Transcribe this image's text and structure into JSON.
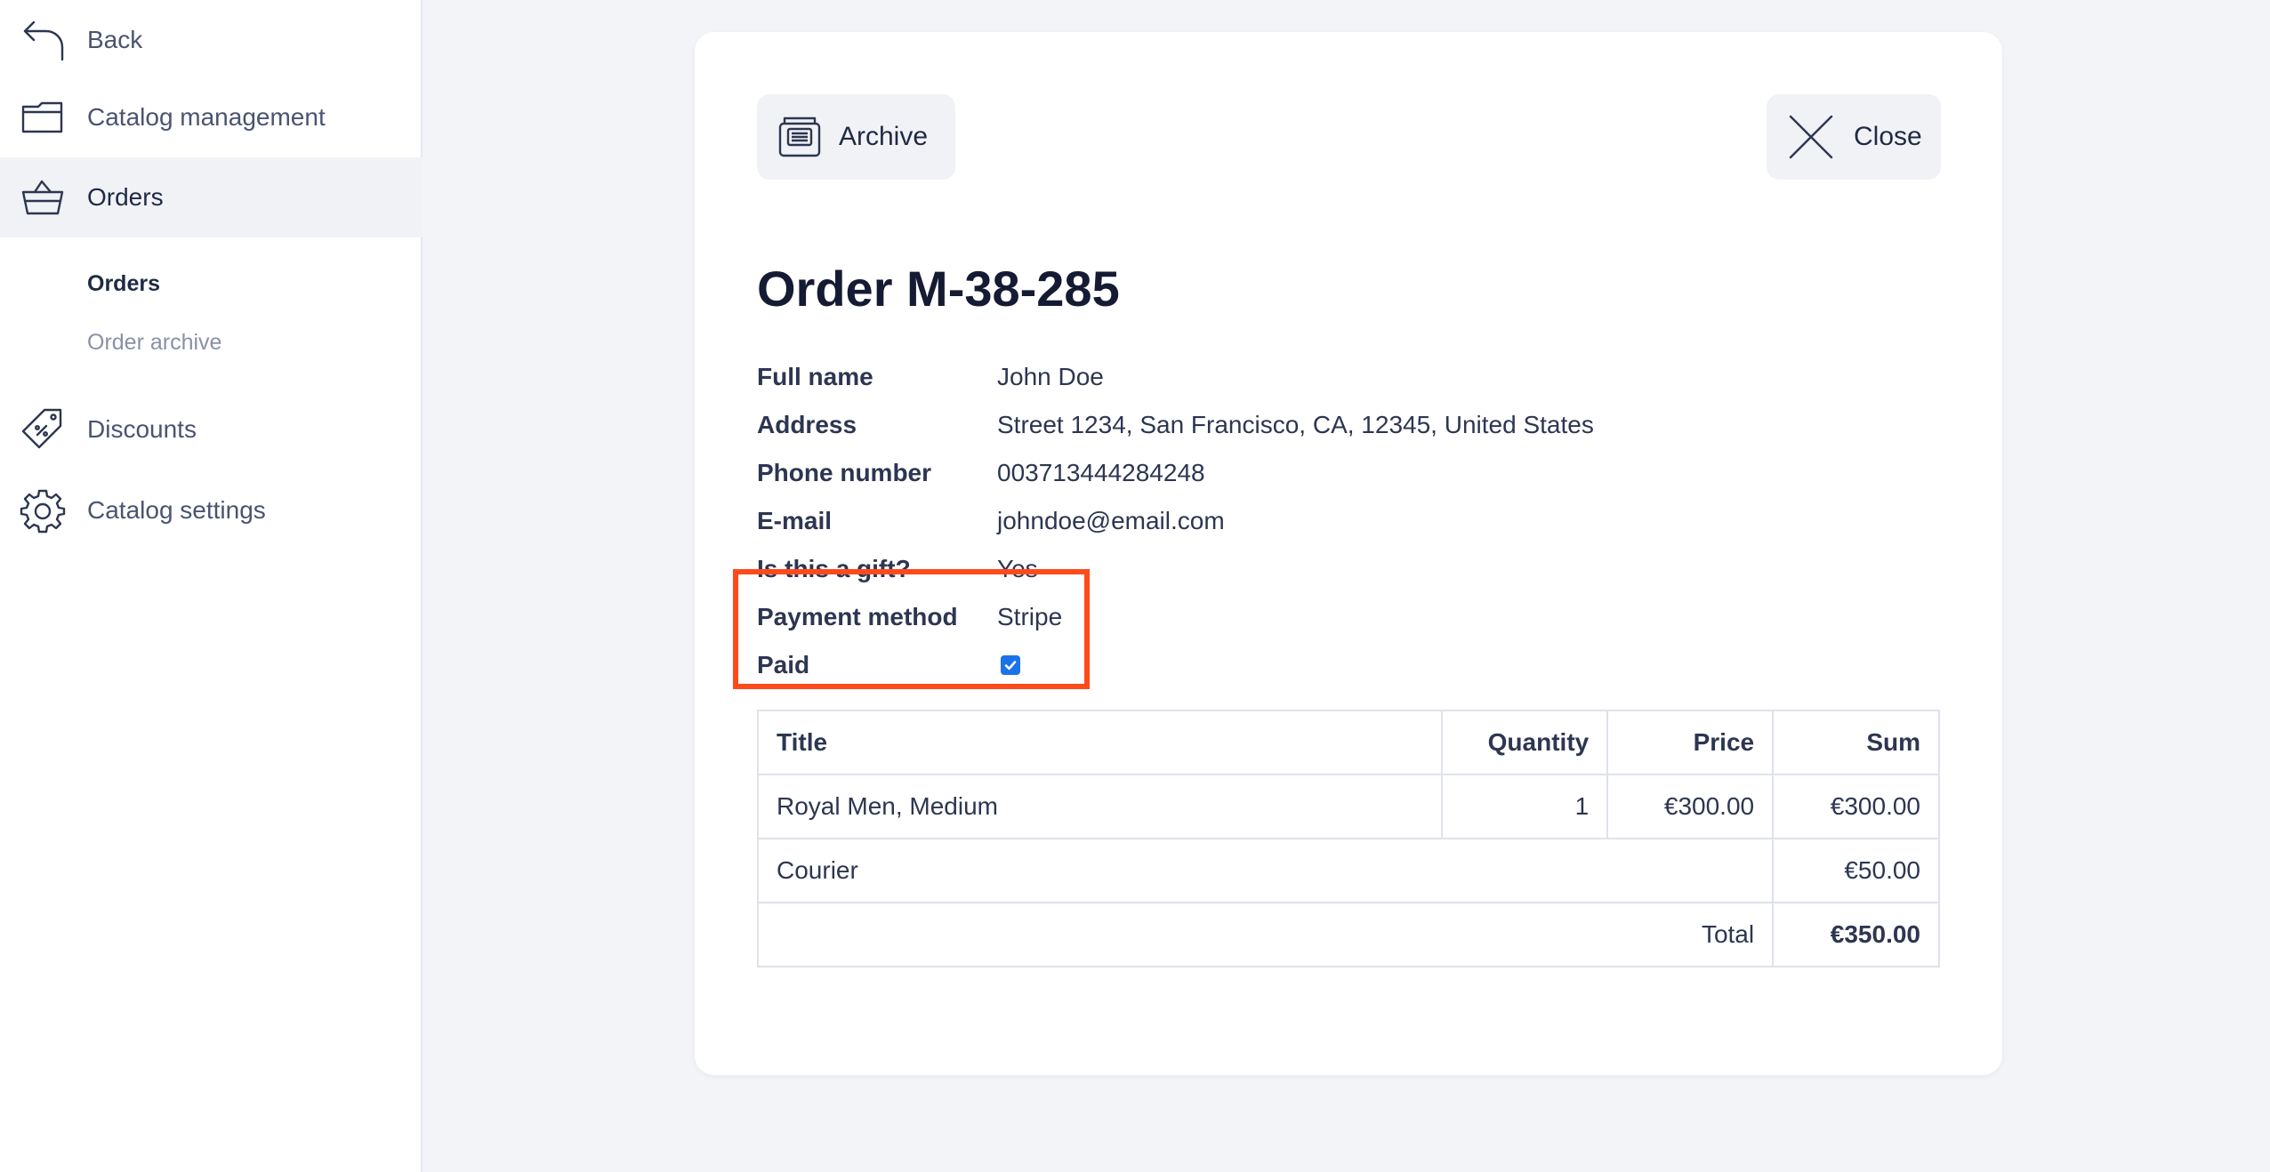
{
  "sidebar": {
    "back": {
      "label": "Back",
      "icon": "back-arrow-icon"
    },
    "items": [
      {
        "label": "Catalog management",
        "icon": "folder-icon"
      },
      {
        "label": "Orders",
        "icon": "basket-icon"
      },
      {
        "label": "Discounts",
        "icon": "tag-icon"
      },
      {
        "label": "Catalog settings",
        "icon": "gear-icon"
      }
    ],
    "sub_items": [
      {
        "label": "Orders"
      },
      {
        "label": "Order archive"
      }
    ]
  },
  "order": {
    "archive_label": "Archive",
    "close_label": "Close",
    "title": "Order M-38-285",
    "fields": [
      {
        "label": "Full name",
        "value": "John Doe"
      },
      {
        "label": "Address",
        "value": "Street 1234, San Francisco, CA, 12345, United States"
      },
      {
        "label": "Phone number",
        "value": "003713444284248"
      },
      {
        "label": "E-mail",
        "value": "johndoe@email.com"
      },
      {
        "label": "Is this a gift?",
        "value": "Yes"
      },
      {
        "label": "Payment method",
        "value": "Stripe"
      },
      {
        "label": "Paid",
        "checked": true
      }
    ],
    "table": {
      "headers": [
        "Title",
        "Quantity",
        "Price",
        "Sum"
      ],
      "rows": [
        {
          "title": "Royal Men, Medium",
          "quantity": "1",
          "price": "€300.00",
          "sum": "€300.00"
        }
      ],
      "shipping": {
        "label": "Courier",
        "sum": "€50.00"
      },
      "total": {
        "label": "Total",
        "sum": "€350.00"
      }
    }
  },
  "colors": {
    "highlight": "#ff4a1c",
    "checkbox": "#1a73e8",
    "sidebar_active": "#f1f2f6"
  }
}
